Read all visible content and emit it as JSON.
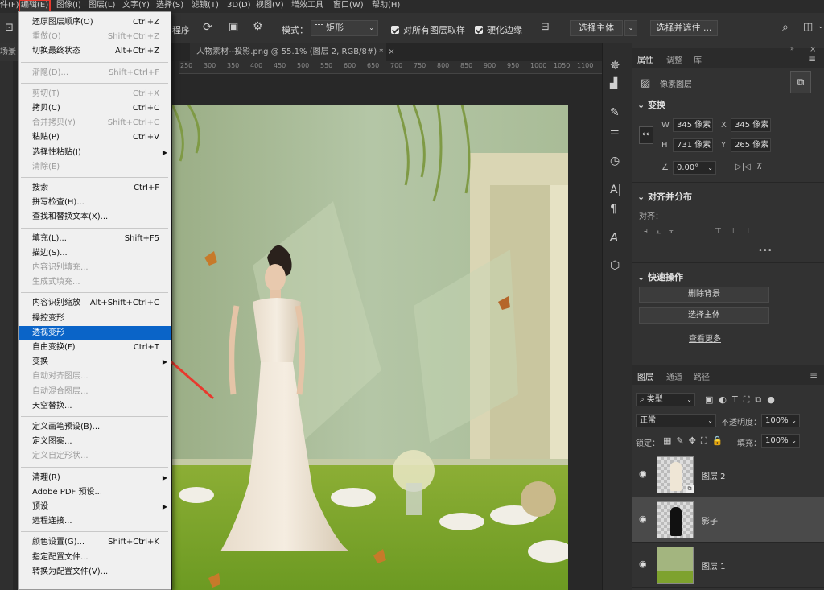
{
  "menubar": {
    "items": [
      "件(F)",
      "编辑(E)",
      "图像(I)",
      "图层(L)",
      "文字(Y)",
      "选择(S)",
      "滤镜(T)",
      "3D(D)",
      "视图(V)",
      "增效工具",
      "窗口(W)",
      "帮助(H)"
    ]
  },
  "options": {
    "order_label": "程序",
    "mode_label": "模式：",
    "mode_value": "矩形",
    "sample_all_label": "对所有图层取样",
    "harden_label": "硬化边缘",
    "select_subject": "选择主体",
    "select_mask": "选择并遮住 ..."
  },
  "tabs": {
    "left": "场景",
    "doc": "人物素材--投影.png @ 55.1% (图层 2, RGB/8#) *"
  },
  "ruler": {
    "ticks": [
      "250",
      "300",
      "350",
      "400",
      "450",
      "500",
      "550",
      "600",
      "650",
      "700",
      "750",
      "800",
      "850",
      "900",
      "950",
      "1000",
      "1050",
      "1100"
    ]
  },
  "edit_menu": {
    "items": [
      {
        "label": "还原图层顺序(O)",
        "shortcut": "Ctrl+Z",
        "state": "normal"
      },
      {
        "label": "重做(O)",
        "shortcut": "Shift+Ctrl+Z",
        "state": "disabled"
      },
      {
        "label": "切换最终状态",
        "shortcut": "Alt+Ctrl+Z",
        "state": "normal"
      },
      {
        "label": "渐隐(D)...",
        "shortcut": "Shift+Ctrl+F",
        "state": "disabled"
      },
      {
        "label": "剪切(T)",
        "shortcut": "Ctrl+X",
        "state": "disabled"
      },
      {
        "label": "拷贝(C)",
        "shortcut": "Ctrl+C",
        "state": "normal"
      },
      {
        "label": "合并拷贝(Y)",
        "shortcut": "Shift+Ctrl+C",
        "state": "disabled"
      },
      {
        "label": "粘贴(P)",
        "shortcut": "Ctrl+V",
        "state": "normal"
      },
      {
        "label": "选择性粘贴(I)",
        "shortcut": "",
        "state": "submenu"
      },
      {
        "label": "清除(E)",
        "shortcut": "",
        "state": "disabled"
      },
      {
        "label": "搜索",
        "shortcut": "Ctrl+F",
        "state": "normal"
      },
      {
        "label": "拼写检查(H)...",
        "shortcut": "",
        "state": "normal"
      },
      {
        "label": "查找和替换文本(X)...",
        "shortcut": "",
        "state": "normal"
      },
      {
        "label": "填充(L)...",
        "shortcut": "Shift+F5",
        "state": "normal"
      },
      {
        "label": "描边(S)...",
        "shortcut": "",
        "state": "normal"
      },
      {
        "label": "内容识别填充...",
        "shortcut": "",
        "state": "disabled"
      },
      {
        "label": "生成式填充...",
        "shortcut": "",
        "state": "disabled"
      },
      {
        "label": "内容识别缩放",
        "shortcut": "Alt+Shift+Ctrl+C",
        "state": "normal"
      },
      {
        "label": "操控变形",
        "shortcut": "",
        "state": "normal"
      },
      {
        "label": "透视变形",
        "shortcut": "",
        "state": "highlighted"
      },
      {
        "label": "自由变换(F)",
        "shortcut": "Ctrl+T",
        "state": "normal"
      },
      {
        "label": "变换",
        "shortcut": "",
        "state": "submenu"
      },
      {
        "label": "自动对齐图层...",
        "shortcut": "",
        "state": "disabled"
      },
      {
        "label": "自动混合图层...",
        "shortcut": "",
        "state": "disabled"
      },
      {
        "label": "天空替换...",
        "shortcut": "",
        "state": "normal"
      },
      {
        "label": "定义画笔预设(B)...",
        "shortcut": "",
        "state": "normal"
      },
      {
        "label": "定义图案...",
        "shortcut": "",
        "state": "normal"
      },
      {
        "label": "定义自定形状...",
        "shortcut": "",
        "state": "disabled"
      },
      {
        "label": "清理(R)",
        "shortcut": "",
        "state": "submenu"
      },
      {
        "label": "Adobe PDF 预设...",
        "shortcut": "",
        "state": "normal"
      },
      {
        "label": "预设",
        "shortcut": "",
        "state": "submenu"
      },
      {
        "label": "远程连接...",
        "shortcut": "",
        "state": "normal"
      },
      {
        "label": "颜色设置(G)...",
        "shortcut": "Shift+Ctrl+K",
        "state": "normal"
      },
      {
        "label": "指定配置文件...",
        "shortcut": "",
        "state": "normal"
      },
      {
        "label": "转换为配置文件(V)...",
        "shortcut": "",
        "state": "normal"
      }
    ]
  },
  "properties": {
    "tabs": [
      "属性",
      "调整",
      "库"
    ],
    "kind": "像素图层",
    "transform_title": "变换",
    "w": "345 像素",
    "h": "731 像素",
    "x": "345 像素",
    "y": "265 像素",
    "angle": "0.00°",
    "align_title": "对齐并分布",
    "align_label": "对齐：",
    "quick_title": "快速操作",
    "remove_bg": "删除背景",
    "select_subject": "选择主体",
    "more": "查看更多",
    "labels": {
      "w": "W",
      "h": "H",
      "x": "X",
      "y": "Y"
    }
  },
  "layers": {
    "tabs": [
      "图层",
      "通道",
      "路径"
    ],
    "filter": "类型",
    "blend": "正常",
    "opacity_label": "不透明度：",
    "opacity": "100%",
    "lock_label": "锁定：",
    "fill_label": "填充：",
    "fill": "100%",
    "items": [
      {
        "name": "图层 2"
      },
      {
        "name": "影子"
      },
      {
        "name": "图层 1"
      }
    ]
  },
  "colors": {
    "accent": "#0a64c8",
    "arrow": "#e8392e",
    "menu_bg": "#f0f0f0",
    "panel_bg": "#323232"
  }
}
